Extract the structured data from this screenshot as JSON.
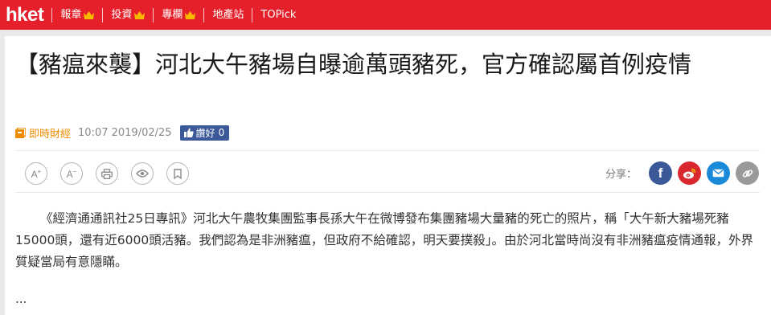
{
  "site": {
    "logo": "hket",
    "nav": [
      {
        "label": "報章",
        "premium": true
      },
      {
        "label": "投資",
        "premium": true
      },
      {
        "label": "專欄",
        "premium": true
      },
      {
        "label": "地產站",
        "premium": false
      },
      {
        "label": "TOPick",
        "premium": false
      }
    ],
    "brand_color": "#e6202b"
  },
  "article": {
    "title": "【豬瘟來襲】河北大午豬場自曝逾萬頭豬死，官方確認屬首例疫情",
    "category": "即時財經",
    "datetime": "10:07 2019/02/25",
    "like_label": "讚好",
    "like_count": "0",
    "tools": [
      {
        "name": "font-increase",
        "glyph": "A+"
      },
      {
        "name": "font-decrease",
        "glyph": "A−"
      },
      {
        "name": "print",
        "glyph": "print"
      },
      {
        "name": "view",
        "glyph": "eye"
      },
      {
        "name": "bookmark",
        "glyph": "bookmark"
      }
    ],
    "share_label": "分享：",
    "share": [
      {
        "name": "facebook",
        "color": "#3b5998"
      },
      {
        "name": "weibo",
        "color": "#d9272e"
      },
      {
        "name": "email",
        "color": "#1a8ad8"
      },
      {
        "name": "link",
        "color": "#9a9a9a"
      }
    ],
    "body": "《經濟通通訊社25日專訊》河北大午農牧集團監事長孫大午在微博發布集團豬場大量豬的死亡的照片，稱「大午新大豬場死豬15000頭，還有近6000頭活豬。我們認為是非洲豬瘟，但政府不給確認，明天要撲殺」。由於河北當時尚沒有非洲豬瘟疫情通報，外界質疑當局有意隱瞞。",
    "ellipsis": "..."
  }
}
